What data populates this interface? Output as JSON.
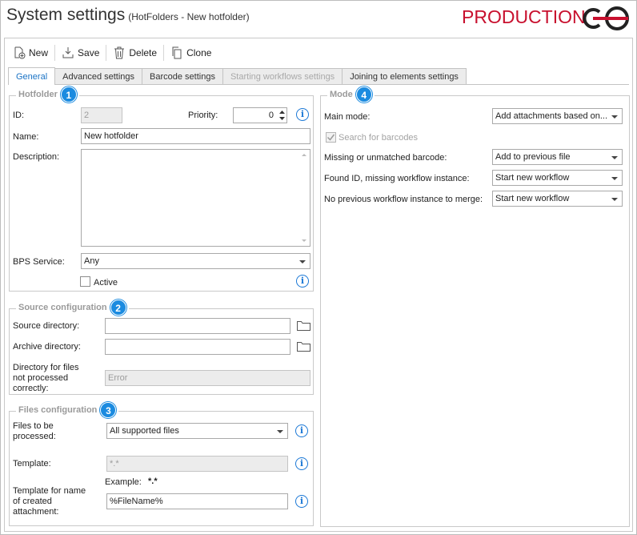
{
  "window": {
    "title": "System settings",
    "subtitle": "(HotFolders - New hotfolder)",
    "environment": "PRODUCTION",
    "accent_color": "#c8102e"
  },
  "toolbar": {
    "new_label": "New",
    "save_label": "Save",
    "delete_label": "Delete",
    "clone_label": "Clone"
  },
  "tabs": [
    {
      "label": "General",
      "state": "active"
    },
    {
      "label": "Advanced settings",
      "state": "normal"
    },
    {
      "label": "Barcode settings",
      "state": "normal"
    },
    {
      "label": "Starting workflows settings",
      "state": "disabled"
    },
    {
      "label": "Joining to elements settings",
      "state": "normal"
    }
  ],
  "hotfolder": {
    "title": "Hotfolder",
    "badge": "1",
    "id_label": "ID:",
    "id_value": "2",
    "priority_label": "Priority:",
    "priority_value": "0",
    "name_label": "Name:",
    "name_value": "New hotfolder",
    "description_label": "Description:",
    "description_value": "",
    "bps_label": "BPS Service:",
    "bps_value": "Any",
    "active_label": "Active",
    "active_checked": false
  },
  "source": {
    "title": "Source configuration",
    "badge": "2",
    "source_dir_label": "Source directory:",
    "source_dir_value": "",
    "archive_dir_label": "Archive directory:",
    "archive_dir_value": "",
    "error_dir_label_1": "Directory for files",
    "error_dir_label_2": "not processed",
    "error_dir_label_3": "correctly:",
    "error_dir_value": "Error"
  },
  "files": {
    "title": "Files configuration",
    "badge": "3",
    "files_label_1": "Files to be",
    "files_label_2": "processed:",
    "files_value": "All supported files",
    "template_label": "Template:",
    "template_value": "*.*",
    "example_label": "Example:",
    "example_value": "*.*",
    "attach_label_1": "Template for name",
    "attach_label_2": "of created",
    "attach_label_3": "attachment:",
    "attach_value": "%FileName%"
  },
  "mode": {
    "title": "Mode",
    "badge": "4",
    "main_mode_label": "Main mode:",
    "main_mode_value": "Add attachments based on...",
    "search_barcodes_label": "Search for barcodes",
    "search_barcodes_checked": true,
    "missing_barcode_label": "Missing or unmatched barcode:",
    "missing_barcode_value": "Add to previous file",
    "found_id_label": "Found ID, missing workflow instance:",
    "found_id_value": "Start new workflow",
    "no_prev_label": "No previous workflow instance to merge:",
    "no_prev_value": "Start new workflow"
  },
  "icons": {
    "info": "info-icon",
    "folder": "folder-icon",
    "new": "new-document-icon",
    "save": "save-icon",
    "delete": "trash-icon",
    "clone": "clone-icon"
  }
}
